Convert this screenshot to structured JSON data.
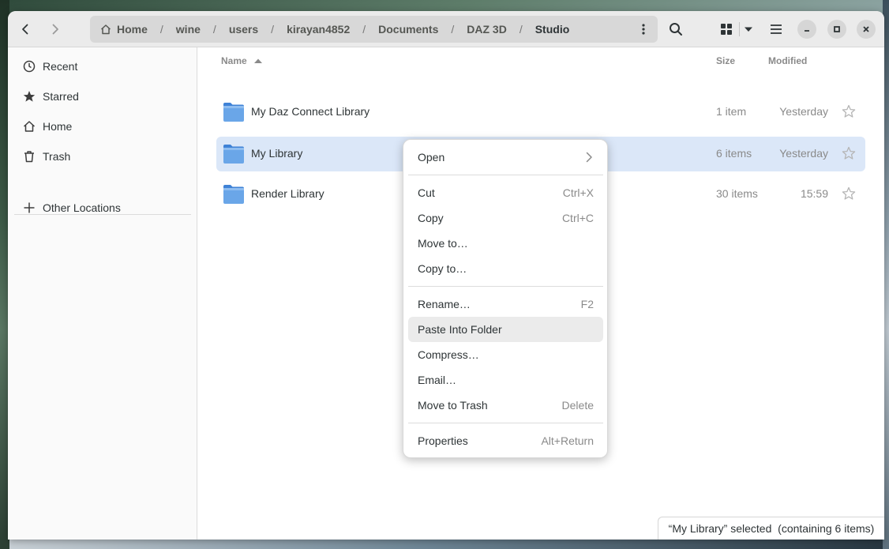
{
  "path": {
    "home_label": "Home",
    "segments": [
      "wine",
      "users",
      "kirayan4852",
      "Documents",
      "DAZ 3D"
    ],
    "current": "Studio"
  },
  "sidebar": {
    "items": [
      {
        "label": "Recent",
        "icon": "clock-icon"
      },
      {
        "label": "Starred",
        "icon": "star-icon"
      },
      {
        "label": "Home",
        "icon": "home-icon"
      },
      {
        "label": "Trash",
        "icon": "trash-icon"
      }
    ],
    "other_locations": "Other Locations"
  },
  "columns": {
    "name": "Name",
    "size": "Size",
    "modified": "Modified"
  },
  "files": [
    {
      "name": "My Daz Connect Library",
      "size": "1 item",
      "modified": "Yesterday"
    },
    {
      "name": "My Library",
      "size": "6 items",
      "modified": "Yesterday",
      "selected": true
    },
    {
      "name": "Render Library",
      "size": "30 items",
      "modified": "15:59"
    }
  ],
  "context_menu": {
    "open": "Open",
    "cut": {
      "label": "Cut",
      "accel": "Ctrl+X"
    },
    "copy": {
      "label": "Copy",
      "accel": "Ctrl+C"
    },
    "move_to": "Move to…",
    "copy_to": "Copy to…",
    "rename": {
      "label": "Rename…",
      "accel": "F2"
    },
    "paste_into": "Paste Into Folder",
    "compress": "Compress…",
    "email": "Email…",
    "trash": {
      "label": "Move to Trash",
      "accel": "Delete"
    },
    "properties": {
      "label": "Properties",
      "accel": "Alt+Return"
    }
  },
  "status": "“My Library” selected  (containing 6 items)",
  "colors": {
    "selection": "#dbe7f8",
    "folder_blue": "#5b9be0",
    "headerbar": "#ebebeb"
  }
}
